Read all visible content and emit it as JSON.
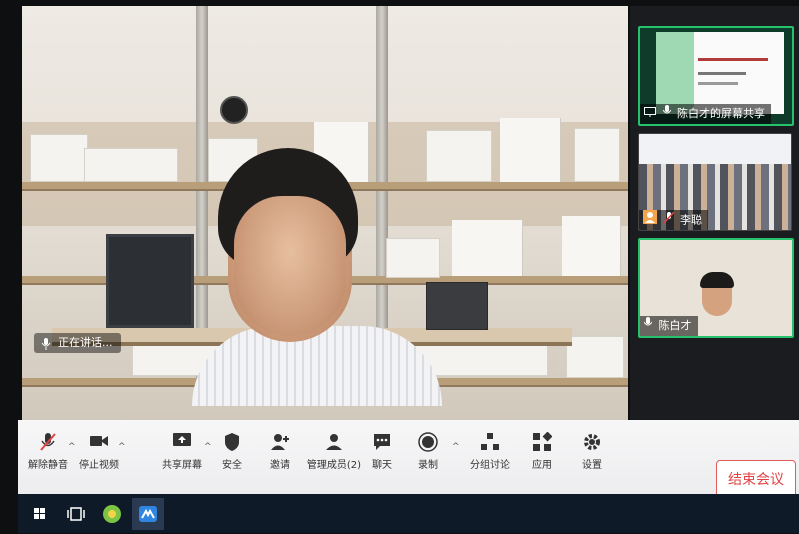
{
  "main_video": {
    "speaker_hint": "正在讲话..."
  },
  "participants": [
    {
      "name": "陈白才的屏幕共享",
      "kind": "screen-share"
    },
    {
      "name": "李聪",
      "kind": "camera"
    },
    {
      "name": "陈白才",
      "kind": "camera"
    }
  ],
  "toolbar": {
    "unmute": "解除静音",
    "stop_video": "停止视频",
    "share_screen": "共享屏幕",
    "security": "安全",
    "invite": "邀请",
    "manage_members": "管理成员(2)",
    "chat": "聊天",
    "record": "录制",
    "breakout": "分组讨论",
    "apps": "应用",
    "settings": "设置",
    "end_meeting": "结束会议"
  },
  "colors": {
    "active_speaker_border": "#26c26b",
    "end_meeting": "#e04343"
  },
  "icons": {
    "collapse": "chevron-right-icon"
  }
}
